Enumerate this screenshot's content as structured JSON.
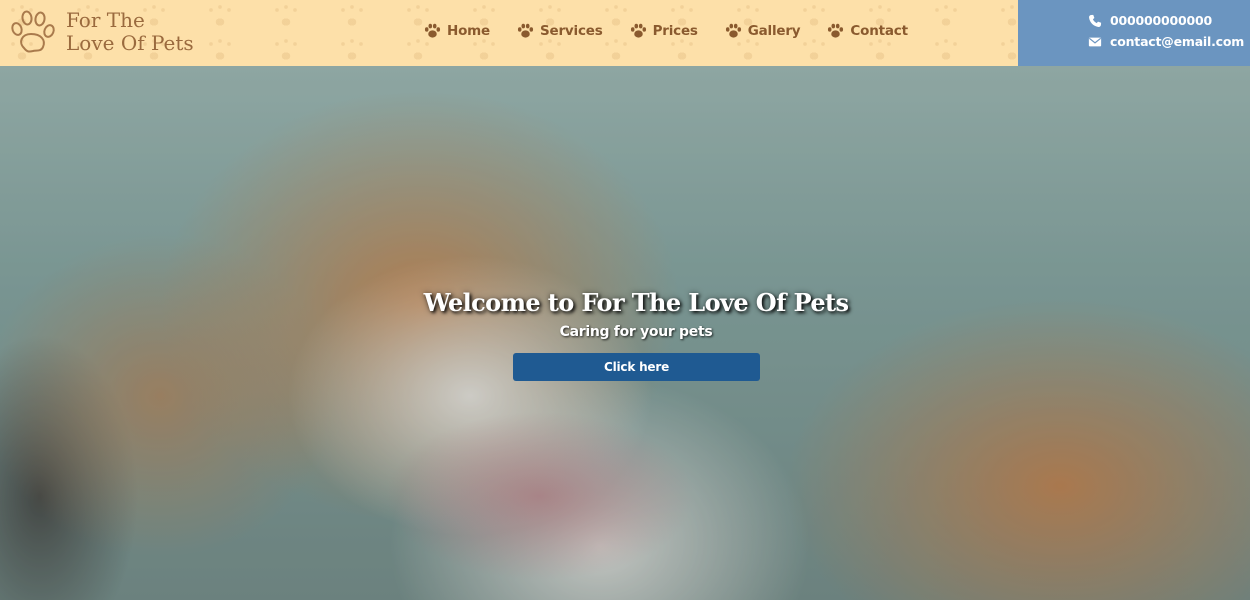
{
  "brand": {
    "name_line1": "For The",
    "name_line2": "Love Of Pets",
    "logo_icon": "paw-icon",
    "color": "#9a6a3e"
  },
  "nav": {
    "items": [
      {
        "label": "Home",
        "icon": "paw-icon"
      },
      {
        "label": "Services",
        "icon": "paw-icon"
      },
      {
        "label": "Prices",
        "icon": "paw-icon"
      },
      {
        "label": "Gallery",
        "icon": "paw-icon"
      },
      {
        "label": "Contact",
        "icon": "paw-icon"
      }
    ],
    "background": "#fde0a9",
    "text_color": "#8a5a2e"
  },
  "contact": {
    "phone": "000000000000",
    "phone_icon": "phone-icon",
    "email": "contact@email.com",
    "email_icon": "envelope-icon",
    "background": "#6b95c0"
  },
  "hero": {
    "title": "Welcome to For The Love Of Pets",
    "subtitle": "Caring for your pets",
    "button_label": "Click here",
    "button_color": "#1f5a92",
    "image": "photo of a ginger-and-white cat licking its paw"
  }
}
